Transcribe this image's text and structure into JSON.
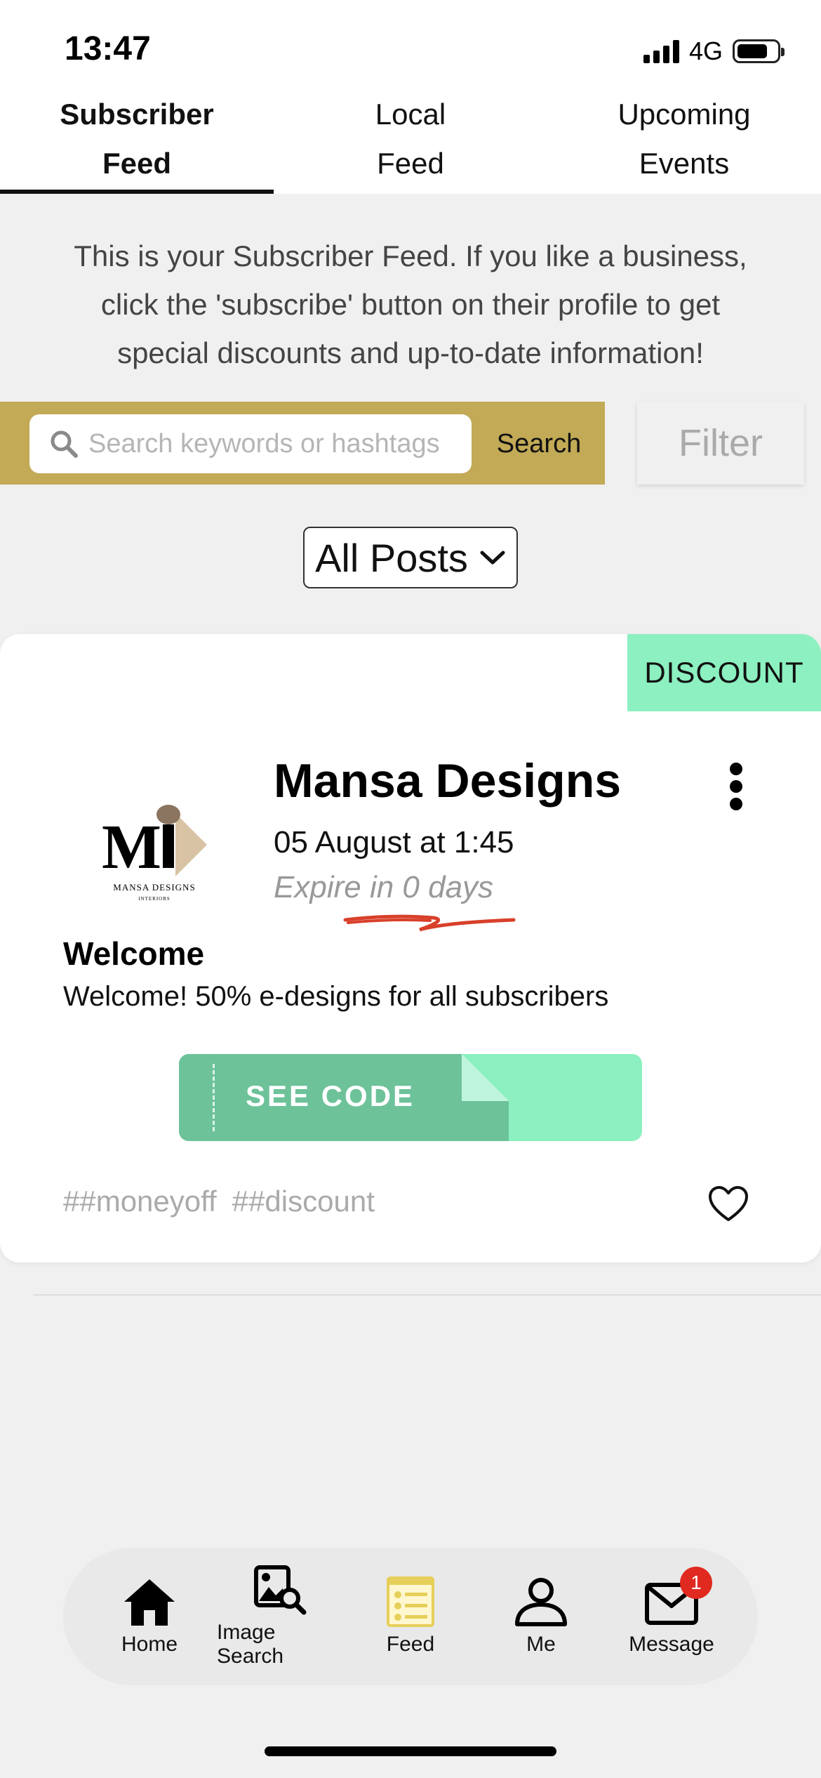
{
  "status": {
    "time": "13:47",
    "network": "4G"
  },
  "tabs": [
    {
      "label": "Subscriber\nFeed",
      "active": true
    },
    {
      "label": "Local\nFeed",
      "active": false
    },
    {
      "label": "Upcoming\nEvents",
      "active": false
    }
  ],
  "intro_text": "This is your Subscriber Feed. If you like a business, click the 'subscribe' button on their profile to get special discounts and up-to-date information!",
  "search": {
    "placeholder": "Search keywords or hashtags",
    "button_label": "Search",
    "filter_label": "Filter"
  },
  "posts_filter": {
    "selected": "All Posts"
  },
  "post": {
    "badge": "DISCOUNT",
    "business_name": "Mansa Designs",
    "logo_text": "MANSA DESIGNS",
    "logo_subtext": "INTERIORS",
    "date": "05 August at 1:45",
    "expire": "Expire in 0 days",
    "title": "Welcome",
    "body": "Welcome! 50% e-designs for all subscribers",
    "code_button": "SEE CODE",
    "tags": [
      "##moneyoff",
      "##discount"
    ]
  },
  "nav": {
    "items": [
      {
        "label": "Home",
        "icon": "home-icon"
      },
      {
        "label": "Image Search",
        "icon": "image-search-icon"
      },
      {
        "label": "Feed",
        "icon": "feed-icon"
      },
      {
        "label": "Me",
        "icon": "person-icon"
      },
      {
        "label": "Message",
        "icon": "mail-icon",
        "badge": "1"
      }
    ]
  },
  "colors": {
    "search_band": "#c2aa56",
    "discount_badge": "#8cf0c0",
    "code_button": "#6dc29a",
    "feed_icon": "#e6cf5a",
    "badge_red": "#e02a20"
  }
}
